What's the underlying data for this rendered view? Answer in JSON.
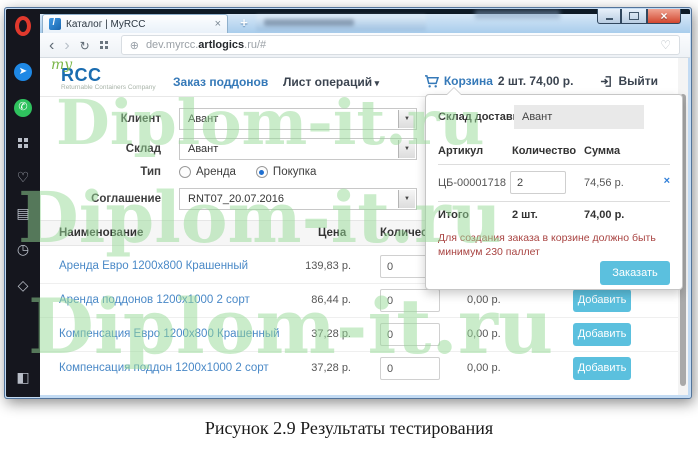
{
  "caption": "Рисунок 2.9 Результаты тестирования",
  "watermark": {
    "text": "Diplom-it.ru"
  },
  "browser": {
    "tab_title": "Каталог | MyRCC",
    "url_prefix": "dev.myrcc.",
    "url_domain": "artlogics",
    "url_suffix": ".ru/#"
  },
  "app": {
    "logo_script": "my",
    "logo_acronym": "RCC",
    "logo_tagline": "Returnable Containers Company",
    "nav_orders": "Заказ поддонов",
    "nav_operations": "Лист операций",
    "cart_label": "Корзина",
    "cart_summary": "2 шт. 74,00 р.",
    "logout_label": "Выйти"
  },
  "form": {
    "client_label": "Клиент",
    "client_value": "Авант",
    "warehouse_label": "Склад",
    "warehouse_value": "Авант",
    "type_label": "Тип",
    "type_option_rent": "Аренда",
    "type_option_purchase": "Покупка",
    "agreement_label": "Соглашение",
    "agreement_value": "RNT07_20.07.2016"
  },
  "catalog": {
    "header_name": "Наименование",
    "header_price": "Цена",
    "header_qty": "Количество",
    "rows": [
      {
        "name": "Аренда Евро 1200x800 Крашенный",
        "price": "139,83 р.",
        "qty": "0",
        "sum": "",
        "button": ""
      },
      {
        "name": "Аренда поддонов 1200x1000 2 сорт",
        "price": "86,44 р.",
        "qty": "0",
        "sum": "0,00 р.",
        "button": "Добавить"
      },
      {
        "name": "Компенсация Евро 1200x800 Крашенный",
        "price": "37,28 р.",
        "qty": "0",
        "sum": "0,00 р.",
        "button": "Добавить"
      },
      {
        "name": "Компенсация поддон 1200x1000 2 сорт",
        "price": "37,28 р.",
        "qty": "0",
        "sum": "0,00 р.",
        "button": "Добавить"
      }
    ]
  },
  "popup": {
    "warehouse_label": "Склад доставки:",
    "warehouse_value": "Авант",
    "header_article": "Артикул",
    "header_qty": "Количество",
    "header_sum": "Сумма",
    "item_article": "ЦБ-00001718",
    "item_qty": "2",
    "item_sum": "74,56 р.",
    "total_label": "Итого",
    "total_qty": "2 шт.",
    "total_sum": "74,00 р.",
    "warning": "Для создания заказа в корзине должно быть минимум 230 паллет",
    "order_button": "Заказать"
  },
  "colors": {
    "accent_blue": "#5bc0de",
    "link_blue": "#4a89c7",
    "warning_red": "#a94442",
    "watermark_green": "#96d996"
  }
}
